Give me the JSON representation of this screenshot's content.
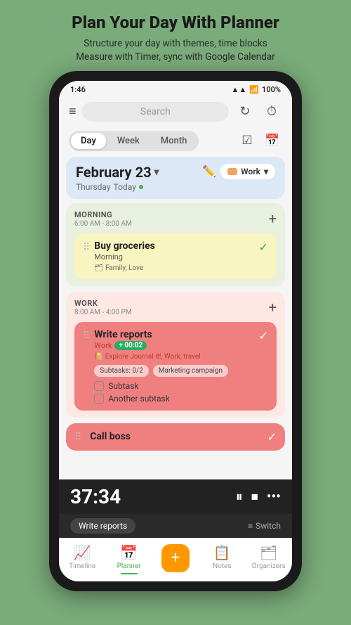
{
  "promo": {
    "title": "Plan Your Day With Planner",
    "subtitle_line1": "Structure your day with themes, time blocks",
    "subtitle_line2": "Measure with Timer, sync with Google Calendar"
  },
  "status_bar": {
    "time": "1:46",
    "battery": "100%"
  },
  "header": {
    "search_placeholder": "Search"
  },
  "tabs": {
    "day": "Day",
    "week": "Week",
    "month": "Month"
  },
  "date_section": {
    "date": "February 23",
    "day_name": "Thursday",
    "day_label": "Today",
    "work_label": "Work"
  },
  "morning_section": {
    "label": "MORNING",
    "time": "6:00 AM - 8:00 AM",
    "task": {
      "title": "Buy groceries",
      "subtitle": "Morning",
      "tags": "Family, Love"
    }
  },
  "work_section": {
    "label": "WORK",
    "time": "8:00 AM - 4:00 PM",
    "task1": {
      "title": "Write reports",
      "subtitle": "Work",
      "timer": "+ 00:02",
      "tags": "Explore Journal it!, Work, travel",
      "subtasks_label": "Subtasks: 0/2",
      "campaign": "Marketing campaign",
      "subtask1": "Subtask",
      "subtask2": "Another subtask"
    },
    "task2": {
      "title": "Call boss"
    }
  },
  "timer": {
    "time": "37:34",
    "task_label": "Write reports",
    "switch_label": "Switch"
  },
  "bottom_nav": {
    "timeline": "Timeline",
    "planner": "Planner",
    "create": "+",
    "notes": "Notes",
    "organizers": "Organizers"
  }
}
